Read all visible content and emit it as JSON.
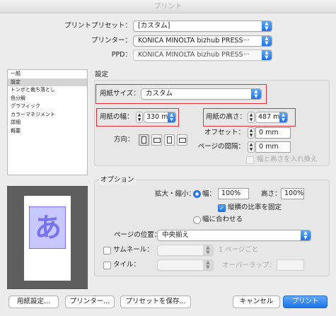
{
  "window": {
    "title": "プリント"
  },
  "header": {
    "preset_label": "プリントプリセット：",
    "preset_value": "[カスタム]",
    "printer_label": "プリンター：",
    "printer_value": "KONICA MINOLTA bizhub PRESS···",
    "ppd_label": "PPD：",
    "ppd_value": "KONICA MINOLTA bizhub PRESS···"
  },
  "sidebar": {
    "items": [
      {
        "label": "一般",
        "selected": false
      },
      {
        "label": "設定",
        "selected": true
      },
      {
        "label": "トンボと裁ち落とし",
        "selected": false
      },
      {
        "label": "色分解",
        "selected": false
      },
      {
        "label": "グラフィック",
        "selected": false
      },
      {
        "label": "カラーマネジメント",
        "selected": false
      },
      {
        "label": "詳細",
        "selected": false
      },
      {
        "label": "概要",
        "selected": false
      }
    ]
  },
  "preview": {
    "glyph": "あ"
  },
  "settings": {
    "section_title": "設定",
    "paper_size_label": "用紙サイズ：",
    "paper_size_value": "カスタム",
    "width_label": "用紙の幅：",
    "width_value": "330 mm",
    "height_label": "用紙の高さ：",
    "height_value": "487 mm",
    "offset_label": "オフセット：",
    "offset_value": "0 mm",
    "gap_label": "ページの間隔：",
    "gap_value": "0 mm",
    "orientation_label": "方向：",
    "swap_label": "幅と高さを入れ換え"
  },
  "options": {
    "section_title": "オプション",
    "scale_label": "拡大・縮小：",
    "width_radio_label": "幅：",
    "scale_width_value": "100%",
    "scale_height_label": "高さ：",
    "scale_height_value": "100%",
    "keep_ratio_label": "縦横の比率を固定",
    "fit_label": "幅に合わせる",
    "page_position_label": "ページの位置：",
    "page_position_value": "中央揃え",
    "thumbnail_label": "サムネール：",
    "thumbnail_suffix": "1 ページごと",
    "tile_label": "タイル：",
    "overlap_label": "オーバーラップ："
  },
  "buttons": {
    "page_setup": "用紙設定...",
    "printer": "プリンター...",
    "save_preset": "プリセットを保存...",
    "cancel": "キャンセル",
    "print": "プリント"
  },
  "colors": {
    "accent": "#1f73e8",
    "highlight_box": "#e0303a",
    "preview_glyph": "#7672f0"
  }
}
